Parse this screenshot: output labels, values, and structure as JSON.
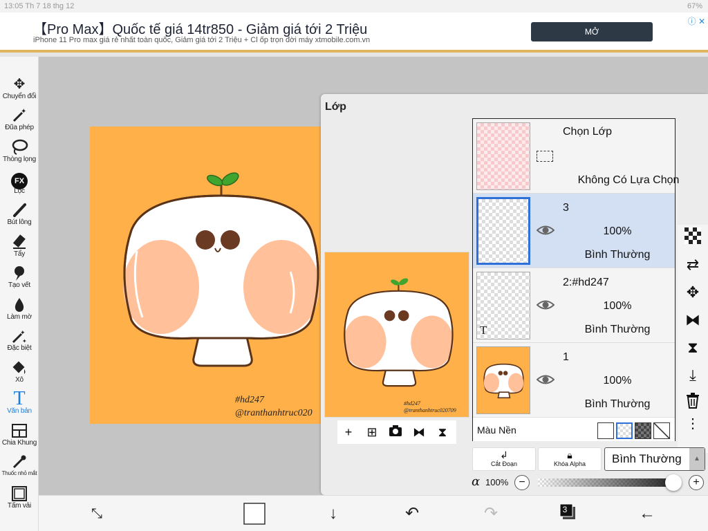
{
  "status": {
    "time": "13:05",
    "date": "Th 7 18 thg 12",
    "battery": "67%"
  },
  "ad": {
    "headline": "【Pro Max】Quốc tế giá 14tr850 - Giảm giá tới 2 Triệu",
    "sub": "iPhone 11 Pro max giá rẻ nhất toàn quốc, Giảm giá tới 2 Triệu + Cl ốp trọn đời máy xtmobile.com.vn",
    "cta": "MỞ"
  },
  "tools": [
    {
      "label": "Chuyển đổi",
      "icon": "move-icon"
    },
    {
      "label": "Đũa phép",
      "icon": "magic-wand-icon"
    },
    {
      "label": "Thòng lọng",
      "icon": "lasso-icon"
    },
    {
      "label": "Lọc",
      "icon": "fx-icon",
      "glyph": "FX"
    },
    {
      "label": "Bút lông",
      "icon": "brush-icon"
    },
    {
      "label": "Tẩy",
      "icon": "eraser-icon"
    },
    {
      "label": "Tạo vết",
      "icon": "smudge-icon"
    },
    {
      "label": "Làm mờ",
      "icon": "blur-drop-icon"
    },
    {
      "label": "Đặc biệt",
      "icon": "special-brush-icon"
    },
    {
      "label": "Xô",
      "icon": "bucket-icon"
    },
    {
      "label": "Văn bản",
      "icon": "text-tool-icon",
      "glyph": "T",
      "active": true
    },
    {
      "label": "Chia Khung",
      "icon": "frame-divider-icon"
    },
    {
      "label": "Thuốc nhỏ mắt",
      "icon": "eyedropper-icon"
    },
    {
      "label": "Tấm vải",
      "icon": "canvas-icon"
    }
  ],
  "canvas": {
    "watermark_line1": "#hd247",
    "watermark_line2": "@tranthanhtruc020",
    "bg_color": "#ffb048"
  },
  "panel": {
    "title": "Lớp",
    "preview_wm1": "#hd247",
    "preview_wm2": "@tranthanhtruc020709",
    "selection_layer": {
      "title": "Chọn Lớp",
      "status": "Không Có Lựa Chọn"
    },
    "layers": [
      {
        "name": "3",
        "opacity": "100%",
        "blend": "Bình Thường",
        "selected": true
      },
      {
        "name": "2:#hd247",
        "opacity": "100%",
        "blend": "Bình Thường",
        "selected": false,
        "text_marker": "T"
      },
      {
        "name": "1",
        "opacity": "100%",
        "blend": "Bình Thường",
        "selected": false
      }
    ],
    "background_label": "Màu Nền",
    "clip_label": "Cắt Đoạn",
    "alpha_lock_label": "Khóa Alpha",
    "blend_mode": "Bình Thường",
    "alpha_symbol": "α",
    "alpha_value": "100%",
    "alpha_level": 1.0
  },
  "bottom": {
    "layers_count": "3"
  },
  "colors": {
    "accent": "#1a7de0",
    "selection": "#2f6fd8",
    "canvas": "#ffb048",
    "peach": "#ffc09a"
  }
}
